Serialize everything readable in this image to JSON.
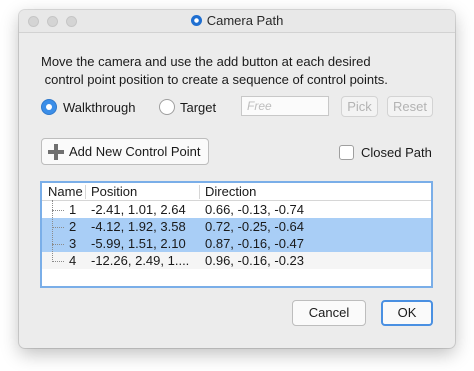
{
  "window": {
    "title": "Camera Path"
  },
  "description": {
    "line1": "Move the camera and use the add button at each desired",
    "line2": " control point position to create a sequence of control points."
  },
  "mode": {
    "options": [
      {
        "label": "Walkthrough",
        "selected": true
      },
      {
        "label": "Target",
        "selected": false
      }
    ],
    "target_field": {
      "value": "",
      "placeholder": "Free"
    },
    "pick_label": "Pick",
    "reset_label": "Reset"
  },
  "add_button_label": "Add New Control Point",
  "closed_path": {
    "label": "Closed Path",
    "checked": false
  },
  "table": {
    "columns": [
      "Name",
      "Position",
      "Direction"
    ],
    "rows": [
      {
        "name": "1",
        "position": "-2.41, 1.01, 2.64",
        "direction": "0.66, -0.13, -0.74",
        "selected": false
      },
      {
        "name": "2",
        "position": "-4.12, 1.92, 3.58",
        "direction": "0.72, -0.25, -0.64",
        "selected": true
      },
      {
        "name": "3",
        "position": "-5.99, 1.51, 2.10",
        "direction": "0.87, -0.16, -0.47",
        "selected": true
      },
      {
        "name": "4",
        "position": "-12.26, 2.49, 1....",
        "direction": "0.96, -0.16, -0.23",
        "selected": false
      }
    ]
  },
  "footer": {
    "cancel_label": "Cancel",
    "ok_label": "OK"
  },
  "colors": {
    "accent": "#3b8ee8",
    "selection": "#a9cef6",
    "table_border": "#7aaee8"
  }
}
